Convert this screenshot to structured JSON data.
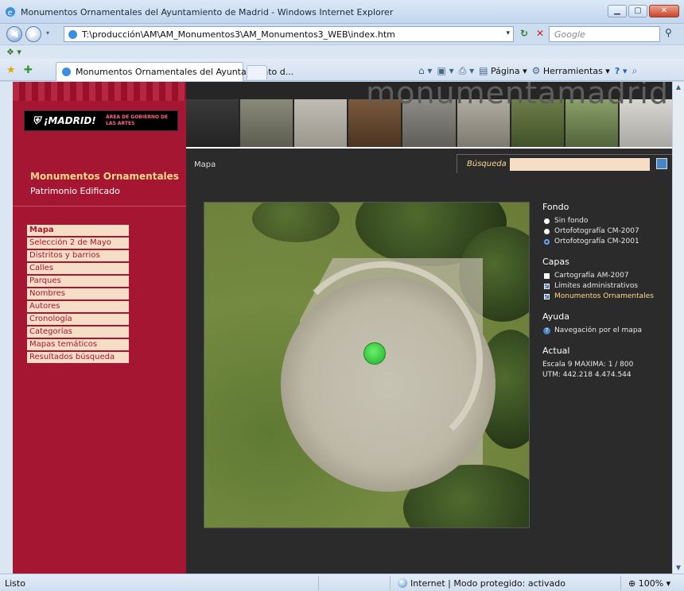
{
  "window": {
    "title": "Monumentos Ornamentales del Ayuntamiento de Madrid - Windows Internet Explorer",
    "url": "T:\\producción\\AM\\AM_Monumentos3\\AM_Monumentos3_WEB\\index.htm",
    "search_placeholder": "Google",
    "tab_title": "Monumentos Ornamentales del Ayuntamiento d...",
    "command_page": "Página ▾",
    "command_tools": "Herramientas ▾"
  },
  "status": {
    "left": "Listo",
    "zone": "Internet | Modo protegido: activado",
    "zoom": "100%"
  },
  "site": {
    "brand": "monumentamadrid",
    "logo_text": "¡MADRID!",
    "logo_area": "ÁREA DE GOBIERNO DE LAS ARTES",
    "title": "Monumentos Ornamentales",
    "subtitle": "Patrimonio Edificado",
    "menu": [
      {
        "label": "Mapa",
        "active": true
      },
      {
        "label": "Selección 2 de Mayo"
      },
      {
        "label": "Distritos y barrios"
      },
      {
        "label": "Calles"
      },
      {
        "label": "Parques"
      },
      {
        "label": "Nombres"
      },
      {
        "label": "Autores"
      },
      {
        "label": "Cronología"
      },
      {
        "label": "Categorías"
      },
      {
        "label": "Mapas temáticos"
      },
      {
        "label": "Resultados búsqueda"
      }
    ],
    "breadcrumb": "Mapa",
    "search_label": "Búsqueda",
    "search_value": ""
  },
  "panel": {
    "fondo": {
      "title": "Fondo",
      "options": [
        {
          "label": "Sin fondo",
          "selected": false
        },
        {
          "label": "Ortofotografía CM-2007",
          "selected": false
        },
        {
          "label": "Ortofotografía CM-2001",
          "selected": true
        }
      ]
    },
    "capas": {
      "title": "Capas",
      "options": [
        {
          "label": "Cartografía AM-2007",
          "checked": false
        },
        {
          "label": "Límites administrativos",
          "checked": true
        },
        {
          "label": "Monumentos Ornamentales",
          "checked": true
        }
      ]
    },
    "ayuda": {
      "title": "Ayuda",
      "link": "Navegación por el mapa"
    },
    "actual": {
      "title": "Actual",
      "escala": "Escala 9 MAXIMA: 1 / 800",
      "utm": "UTM: 442.218 4.474.544"
    }
  },
  "colors": {
    "sidebar_red": "#a51632",
    "menu_bg": "#f6ddc6",
    "highlight": "#ffd88a",
    "page_bg": "#2b2b2b"
  }
}
